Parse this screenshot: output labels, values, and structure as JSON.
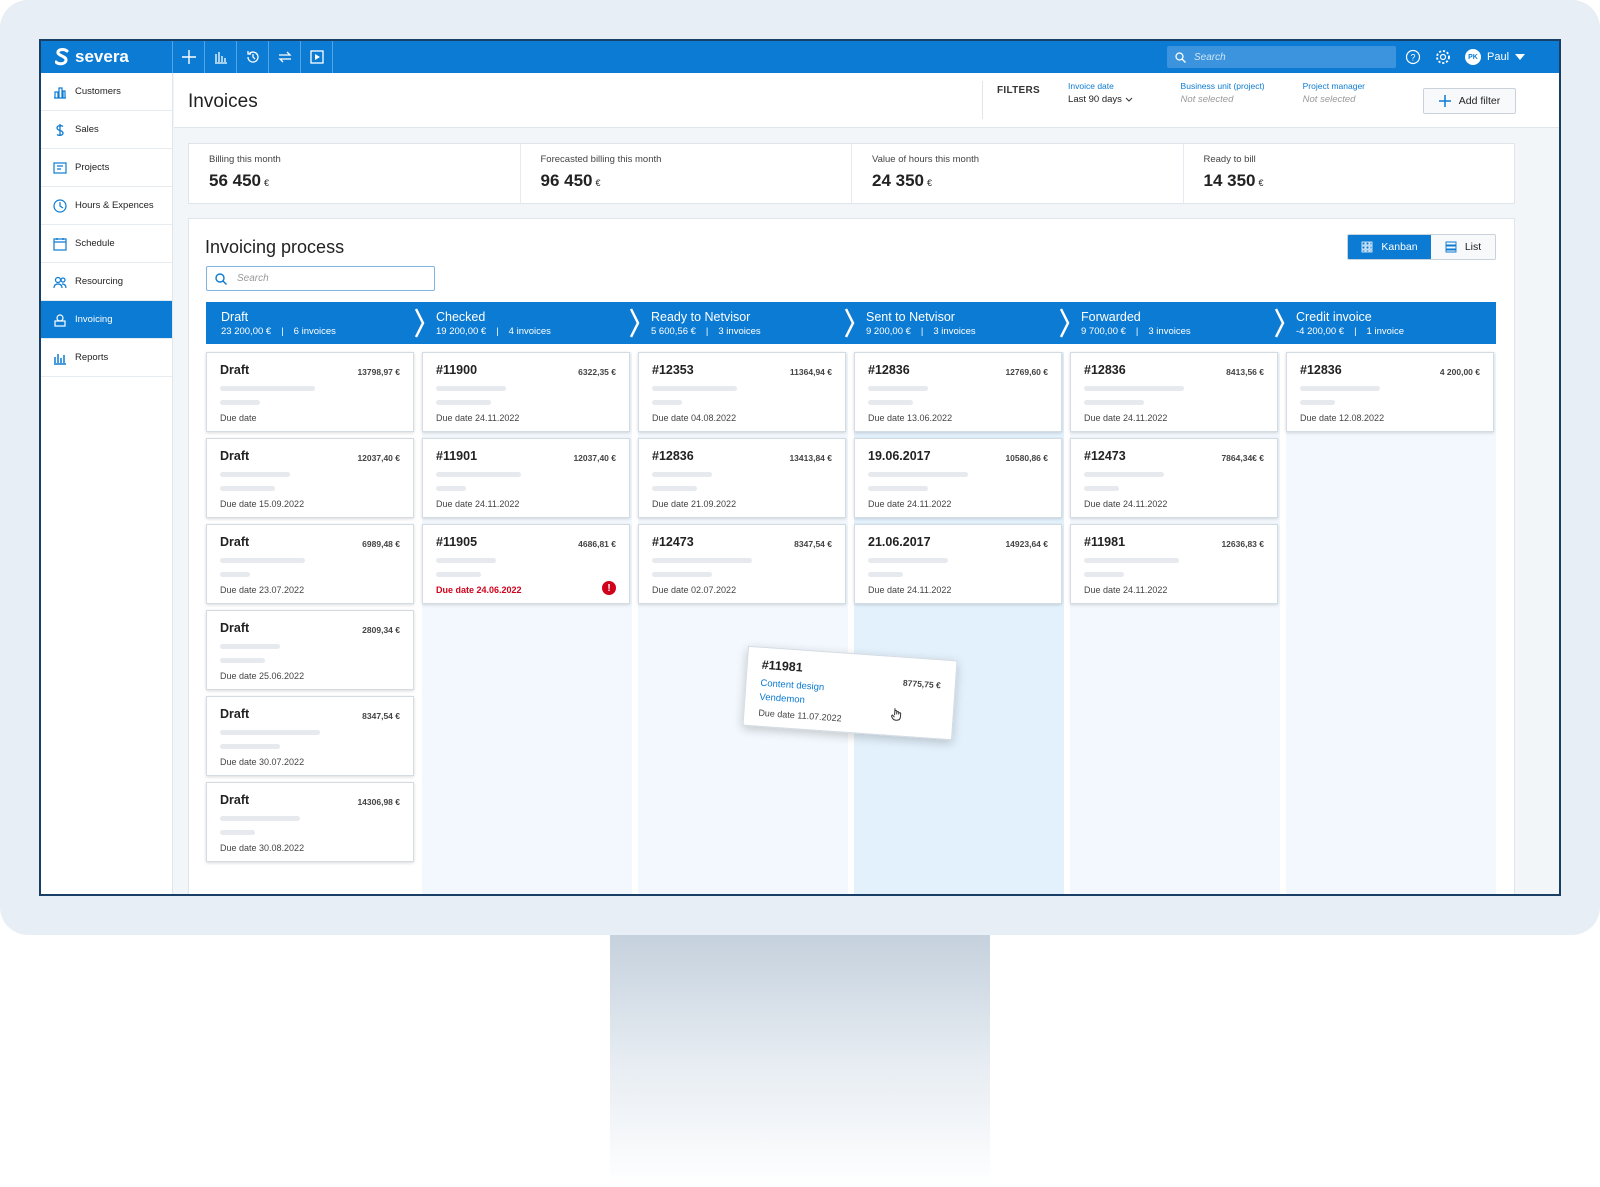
{
  "app": {
    "name": "severa"
  },
  "topbar": {
    "search_placeholder": "Search",
    "user_initials": "PK",
    "user_name": "Paul"
  },
  "sidebar": {
    "items": [
      {
        "label": "Customers",
        "icon": "customers-icon"
      },
      {
        "label": "Sales",
        "icon": "dollar-icon"
      },
      {
        "label": "Projects",
        "icon": "projects-icon"
      },
      {
        "label": "Hours & Expences",
        "icon": "clock-icon"
      },
      {
        "label": "Schedule",
        "icon": "calendar-icon"
      },
      {
        "label": "Resourcing",
        "icon": "people-icon"
      },
      {
        "label": "Invoicing",
        "icon": "invoice-icon",
        "active": true
      },
      {
        "label": "Reports",
        "icon": "bar-chart-icon"
      }
    ]
  },
  "header": {
    "title": "Invoices",
    "filters_label": "FILTERS",
    "filters": [
      {
        "title": "Invoice date",
        "value": "Last 90 days"
      },
      {
        "title": "Business unit (project)",
        "value": "Not selected"
      },
      {
        "title": "Project manager",
        "value": "Not selected"
      }
    ],
    "add_filter": "Add filter"
  },
  "stats": [
    {
      "label": "Billing this month",
      "value": "56 450",
      "unit": "€"
    },
    {
      "label": "Forecasted billing this month",
      "value": "96 450",
      "unit": "€"
    },
    {
      "label": "Value of hours this month",
      "value": "24 350",
      "unit": "€"
    },
    {
      "label": "Ready to bill",
      "value": "14 350",
      "unit": "€"
    }
  ],
  "process": {
    "title": "Invoicing process",
    "search_placeholder": "Search",
    "view_kanban": "Kanban",
    "view_list": "List",
    "stages": [
      {
        "name": "Draft",
        "total": "23 200,00 €",
        "count": "6 invoices"
      },
      {
        "name": "Checked",
        "total": "19 200,00 €",
        "count": "4 invoices"
      },
      {
        "name": "Ready to Netvisor",
        "total": "5 600,56 €",
        "count": "3 invoices"
      },
      {
        "name": "Sent to Netvisor",
        "total": "9 200,00 €",
        "count": "3 invoices"
      },
      {
        "name": "Forwarded",
        "total": "9 700,00 €",
        "count": "3 invoices"
      },
      {
        "name": "Credit invoice",
        "total": "-4 200,00 €",
        "count": "1 invoice"
      }
    ],
    "columns": [
      [
        {
          "title": "Draft",
          "amount": "13798,97 €",
          "due": "Due date"
        },
        {
          "title": "Draft",
          "amount": "12037,40 €",
          "due": "Due date  15.09.2022"
        },
        {
          "title": "Draft",
          "amount": "6989,48 €",
          "due": "Due date  23.07.2022"
        },
        {
          "title": "Draft",
          "amount": "2809,34 €",
          "due": "Due date  25.06.2022"
        },
        {
          "title": "Draft",
          "amount": "8347,54 €",
          "due": "Due date  30.07.2022"
        },
        {
          "title": "Draft",
          "amount": "14306,98 €",
          "due": "Due date  30.08.2022"
        }
      ],
      [
        {
          "title": "#11900",
          "amount": "6322,35 €",
          "due": "Due date  24.11.2022"
        },
        {
          "title": "#11901",
          "amount": "12037,40 €",
          "due": "Due date  24.11.2022"
        },
        {
          "title": "#11905",
          "amount": "4686,81 €",
          "due": "Due date  24.06.2022",
          "overdue": true
        }
      ],
      [
        {
          "title": "#12353",
          "amount": "11364,94 €",
          "due": "Due date  04.08.2022"
        },
        {
          "title": "#12836",
          "amount": "13413,84 €",
          "due": "Due date  21.09.2022"
        },
        {
          "title": "#12473",
          "amount": "8347,54 €",
          "due": "Due date  02.07.2022"
        }
      ],
      [
        {
          "title": "#12836",
          "amount": "12769,60 €",
          "due": "Due date  13.06.2022"
        },
        {
          "title": "19.06.2017",
          "amount": "10580,86 €",
          "due": "Due date  24.11.2022"
        },
        {
          "title": "21.06.2017",
          "amount": "14923,64 €",
          "due": "Due date  24.11.2022"
        }
      ],
      [
        {
          "title": "#12836",
          "amount": "8413,56 €",
          "due": "Due date  24.11.2022"
        },
        {
          "title": "#12473",
          "amount": "7864,34€ €",
          "due": "Due date  24.11.2022"
        },
        {
          "title": "#11981",
          "amount": "12636,83 €",
          "due": "Due date  24.11.2022"
        }
      ],
      [
        {
          "title": "#12836",
          "amount": "4 200,00 €",
          "due": "Due date  12.08.2022"
        }
      ]
    ],
    "dragged_card": {
      "title": "#11981",
      "amount": "8775,75 €",
      "project": "Content design",
      "customer": "Vendemon",
      "due": "Due date  11.07.2022"
    }
  },
  "colors": {
    "accent": "#0c7bd3",
    "danger": "#d0021b"
  }
}
